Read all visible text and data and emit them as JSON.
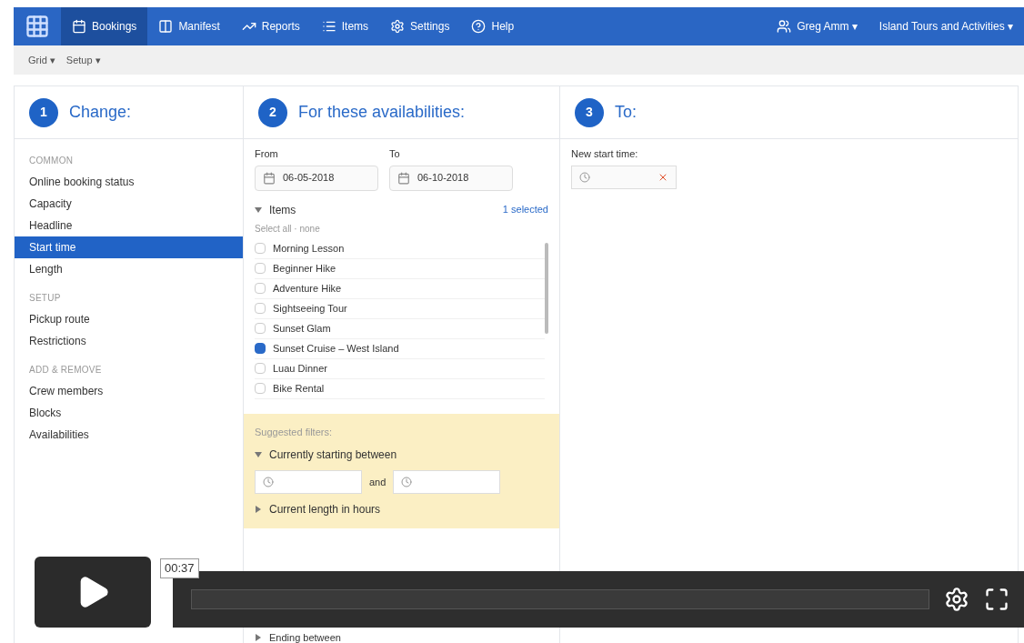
{
  "nav": {
    "tabs": [
      {
        "label": "Bookings",
        "selected": true
      },
      {
        "label": "Manifest",
        "selected": false
      },
      {
        "label": "Reports",
        "selected": false
      },
      {
        "label": "Items",
        "selected": false
      },
      {
        "label": "Settings",
        "selected": false
      },
      {
        "label": "Help",
        "selected": false
      }
    ],
    "user": "Greg Amm ▾",
    "company": "Island Tours and Activities ▾"
  },
  "subbar": {
    "menus": [
      "Grid ▾",
      "Setup ▾"
    ]
  },
  "change": {
    "step": "1",
    "title": "Change:",
    "groups": [
      {
        "heading": "COMMON",
        "items": [
          {
            "label": "Online booking status",
            "selected": false
          },
          {
            "label": "Capacity",
            "selected": false
          },
          {
            "label": "Headline",
            "selected": false
          },
          {
            "label": "Start time",
            "selected": true
          },
          {
            "label": "Length",
            "selected": false
          }
        ]
      },
      {
        "heading": "SETUP",
        "items": [
          {
            "label": "Pickup route",
            "selected": false
          },
          {
            "label": "Restrictions",
            "selected": false
          }
        ]
      },
      {
        "heading": "ADD & REMOVE",
        "items": [
          {
            "label": "Crew members",
            "selected": false
          },
          {
            "label": "Blocks",
            "selected": false
          },
          {
            "label": "Availabilities",
            "selected": false
          }
        ]
      }
    ]
  },
  "availabilities": {
    "step": "2",
    "title": "For these availabilities:",
    "from": {
      "label": "From",
      "value": "06-05-2018"
    },
    "to": {
      "label": "To",
      "value": "06-10-2018"
    },
    "items": {
      "label": "Items",
      "expanded": true,
      "count": "1 selected",
      "select_links": "Select all · none",
      "list": [
        {
          "label": "Morning Lesson",
          "checked": false
        },
        {
          "label": "Beginner Hike",
          "checked": false
        },
        {
          "label": "Adventure Hike",
          "checked": false
        },
        {
          "label": "Sightseeing Tour",
          "checked": false
        },
        {
          "label": "Sunset Glam",
          "checked": false
        },
        {
          "label": "Sunset Cruise – West Island",
          "checked": true
        },
        {
          "label": "Luau Dinner",
          "checked": false
        },
        {
          "label": "Bike Rental",
          "checked": false
        }
      ]
    },
    "suggested": {
      "heading": "Suggested filters:",
      "filters": [
        {
          "label": "Currently starting between",
          "expanded": true,
          "joiner": "and"
        },
        {
          "label": "Current length in hours",
          "expanded": false
        }
      ]
    },
    "below": {
      "label": "Ending between",
      "expanded": false
    }
  },
  "to": {
    "step": "3",
    "title": "To:",
    "field_label": "New start time:"
  },
  "video": {
    "time": "00:37"
  }
}
